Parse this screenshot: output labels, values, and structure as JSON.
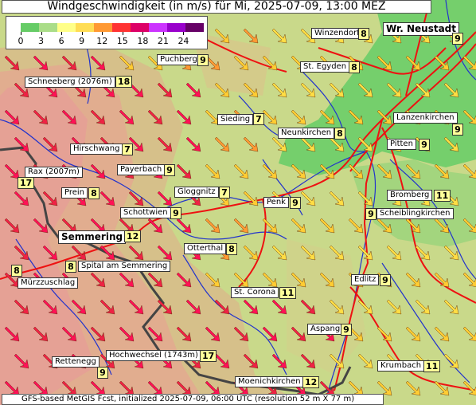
{
  "title": "Windgeschwindigkeit (in m/s) für Mi, 2025-07-09, 13:00 MEZ",
  "legend": {
    "ticks": [
      "0",
      "3",
      "6",
      "9",
      "12",
      "15",
      "18",
      "21",
      "24"
    ],
    "colors": [
      "#66cc66",
      "#aadd88",
      "#ffff88",
      "#ffdd55",
      "#ff9933",
      "#ff3333",
      "#dd0066",
      "#cc33ff",
      "#9900cc",
      "#660066"
    ]
  },
  "places": [
    {
      "name": "Winzendorf",
      "value": "8"
    },
    {
      "name": "Wr. Neustadt",
      "value": "9"
    },
    {
      "name": "Puchberg",
      "value": "9"
    },
    {
      "name": "St. Egyden",
      "value": "8"
    },
    {
      "name": "Schneeberg (2076m)",
      "value": "18"
    },
    {
      "name": "Sieding",
      "value": "7"
    },
    {
      "name": "Neunkirchen",
      "value": "8"
    },
    {
      "name": "Lanzenkirchen",
      "value": "9"
    },
    {
      "name": "Pitten",
      "value": "9"
    },
    {
      "name": "Hirschwang",
      "value": "7"
    },
    {
      "name": "Payerbach",
      "value": "9"
    },
    {
      "name": "Rax (2007m)",
      "value": "17"
    },
    {
      "name": "Prein",
      "value": "8"
    },
    {
      "name": "Gloggnitz",
      "value": "7"
    },
    {
      "name": "Penk",
      "value": "9"
    },
    {
      "name": "Bromberg",
      "value": "11"
    },
    {
      "name": "Schottwien",
      "value": "9"
    },
    {
      "name": "Scheiblingkirchen",
      "value": "9"
    },
    {
      "name": "Semmering",
      "value": "12"
    },
    {
      "name": "Otterthal",
      "value": "8"
    },
    {
      "name": "Spital am Semmering",
      "value": "8"
    },
    {
      "name": "Mürzzuschlag",
      "value": "8"
    },
    {
      "name": "Edlitz",
      "value": "9"
    },
    {
      "name": "St. Corona",
      "value": "11"
    },
    {
      "name": "Aspang",
      "value": "9"
    },
    {
      "name": "Hochwechsel (1743m)",
      "value": "17"
    },
    {
      "name": "Rettenegg",
      "value": "9"
    },
    {
      "name": "Krumbach",
      "value": "11"
    },
    {
      "name": "Moenichkirchen",
      "value": "12"
    }
  ],
  "footer": "GFS-based MetGIS Fcst, initialized 2025-07-09, 06:00 UTC  (resolution 52 m X 77 m)",
  "arrow_direction": "south-east",
  "colors": {
    "lowland": "#66cc66",
    "plain": "#c9d98a",
    "relief": "#e0a080",
    "roads": "#ee1111",
    "rivers": "#2233cc",
    "border": "#444444"
  }
}
